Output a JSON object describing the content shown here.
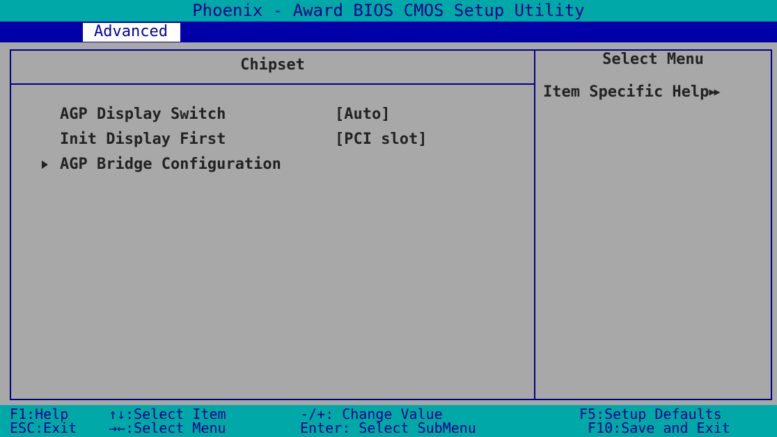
{
  "window": {
    "title": "Phoenix - Award BIOS CMOS Setup Utility"
  },
  "menu": {
    "active_tab": "Advanced"
  },
  "panel": {
    "title": "Chipset",
    "items": [
      {
        "label": "AGP Display Switch",
        "value": "[Auto]",
        "submenu": false
      },
      {
        "label": "Init Display First",
        "value": "[PCI slot]",
        "submenu": false
      },
      {
        "label": "AGP Bridge Configuration",
        "value": "",
        "submenu": true
      }
    ]
  },
  "help": {
    "title": "Select Menu",
    "subtitle": "Item Specific Help",
    "subtitle_icon": "double-right-arrow-icon"
  },
  "status": {
    "f1": "F1:Help",
    "esc": "ESC:Exit",
    "select_item": "↑↓:Select Item",
    "select_menu": "→←:Select Menu",
    "change_value": "-/+: Change Value",
    "enter": "Enter: Select SubMenu",
    "f5": "F5:Setup Defaults",
    "f10": "F10:Save and Exit"
  },
  "colors": {
    "title_bar": "#00a8a8",
    "menu_bar": "#0000a8",
    "panel_bg": "#a8a8a8",
    "frame_lines": "#000084",
    "text": "#222222"
  }
}
